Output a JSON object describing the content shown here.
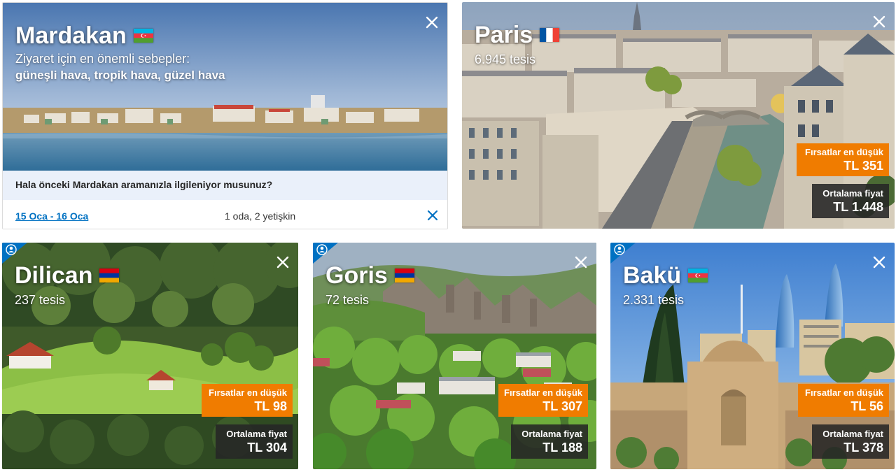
{
  "cards": {
    "mardakan": {
      "name": "Mardakan",
      "flag": "azerbaijan-flag",
      "reasons_heading": "Ziyaret için en önemli sebepler:",
      "reasons": "güneşli hava, tropik hava, güzel hava",
      "prompt": "Hala önceki Mardakan aramanızla ilgileniyor musunuz?",
      "dates": "15 Oca - 16 Oca",
      "guests": "1 oda, 2 yetişkin"
    },
    "paris": {
      "name": "Paris",
      "flag": "france-flag",
      "count": "6.945 tesis",
      "deal_label": "Fırsatlar en düşük",
      "deal_price": "TL 351",
      "avg_label": "Ortalama fiyat",
      "avg_price": "TL 1.448"
    },
    "dilican": {
      "name": "Dilican",
      "flag": "armenia-flag",
      "count": "237 tesis",
      "deal_label": "Fırsatlar en düşük",
      "deal_price": "TL 98",
      "avg_label": "Ortalama fiyat",
      "avg_price": "TL 304"
    },
    "goris": {
      "name": "Goris",
      "flag": "armenia-flag",
      "count": "72 tesis",
      "deal_label": "Fırsatlar en düşük",
      "deal_price": "TL 307",
      "avg_label": "Ortalama fiyat",
      "avg_price": "TL 188"
    },
    "baku": {
      "name": "Bakü",
      "flag": "azerbaijan-flag",
      "count": "2.331 tesis",
      "deal_label": "Fırsatlar en düşük",
      "deal_price": "TL 56",
      "avg_label": "Ortalama fiyat",
      "avg_price": "TL 378"
    }
  },
  "colors": {
    "deal_orange": "#f07c00",
    "avg_dark": "#262626",
    "link_blue": "#0071c2",
    "prompt_bg": "#eaf0fa"
  },
  "icons": {
    "close": "close-icon",
    "recent_search": "user-icon"
  }
}
